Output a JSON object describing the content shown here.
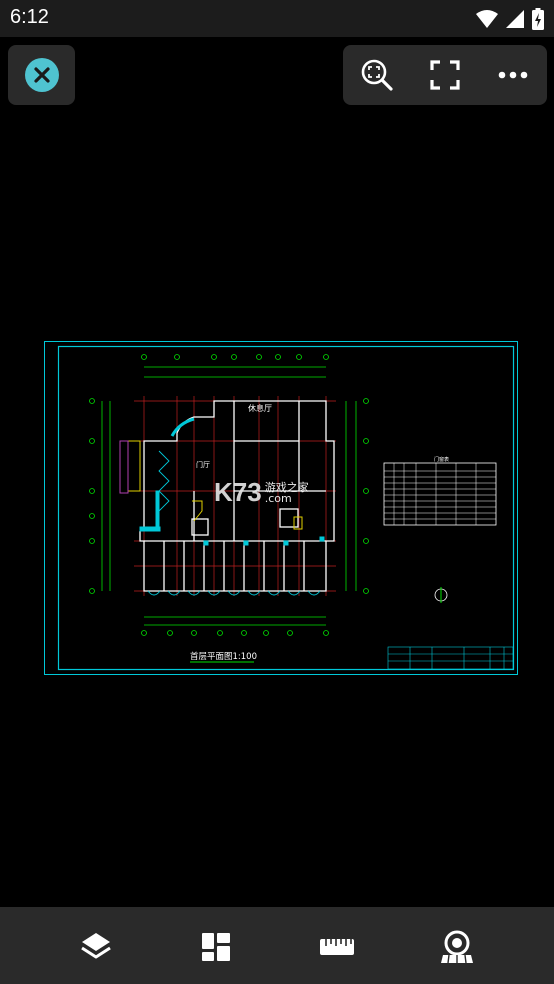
{
  "status_bar": {
    "time": "6:12"
  },
  "toolbar": {
    "close": "close-icon",
    "zoom_extents": "zoom-fit-icon",
    "fullscreen": "fullscreen-icon",
    "more": "more-icon"
  },
  "drawing": {
    "plan_title": "首层平面图1:100",
    "room_label_main": "休息厅",
    "room_label_door": "门厅",
    "table_title": "门窗表"
  },
  "watermark": {
    "brand": "K73",
    "site_text": "游戏之家",
    "domain": ".com"
  },
  "bottom_bar": {
    "layers": "layers-icon",
    "layouts": "layouts-icon",
    "measure": "ruler-icon",
    "view": "view-mode-icon"
  },
  "colors": {
    "cad_cyan": "#00c8d8",
    "cad_green": "#00e000",
    "cad_white": "#ffffff",
    "cad_red": "#c02020",
    "accent": "#4fc3d0",
    "panel": "#2a2a2a"
  }
}
